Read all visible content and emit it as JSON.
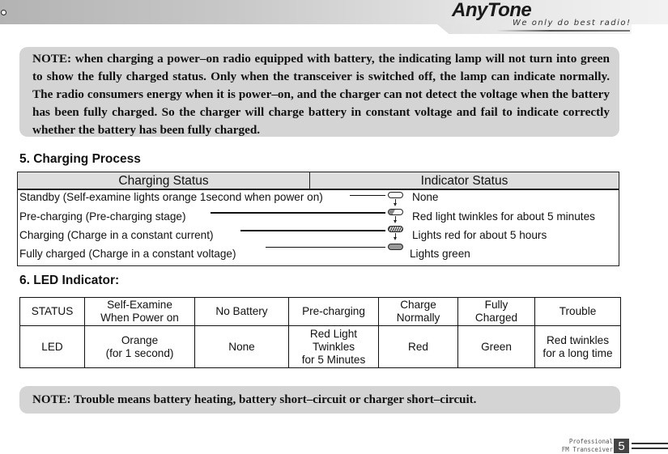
{
  "header": {
    "brand": "AnyTone",
    "tagline": "We only do best radio!"
  },
  "note_top": "NOTE: when charging a power–on radio equipped with battery, the indicating lamp will not turn into green to show the fully charged status. Only when the transceiver is switched off,  the lamp can indicate normally. The radio consumers energy when it is power–on, and the charger can not detect the voltage when the battery has been fully charged. So the charger will charge battery in constant voltage and fail to indicate correctly whether the battery has been fully charged.",
  "section5": {
    "title": "5.  Charging Process",
    "headers": [
      "Charging Status",
      "Indicator Status"
    ],
    "rows": [
      {
        "status": "Standby (Self-examine lights orange 1second when power on)",
        "indicator": "None",
        "icon": "led-off-icon"
      },
      {
        "status": "Pre-charging (Pre-charging stage)",
        "indicator": "Red light twinkles for about 5 minutes",
        "icon": "led-twinkle-icon"
      },
      {
        "status": "Charging (Charge in a constant current)",
        "indicator": "Lights red for about 5 hours",
        "icon": "led-red-icon"
      },
      {
        "status": "Fully charged (Charge in a constant voltage)",
        "indicator": "Lights green",
        "icon": "led-green-icon"
      }
    ]
  },
  "section6": {
    "title": "6.  LED Indicator:",
    "status_row": [
      "STATUS",
      "Self-Examine\nWhen Power on",
      "No Battery",
      "Pre-charging",
      "Charge\nNormally",
      "Fully\nCharged",
      "Trouble"
    ],
    "led_row": [
      "LED",
      "Orange\n(for 1 second)",
      "None",
      "Red Light\nTwinkles\nfor 5 Minutes",
      "Red",
      "Green",
      "Red twinkles\nfor a long time"
    ]
  },
  "note_bottom": "NOTE: Trouble means battery heating, battery short–circuit or charger short–circuit.",
  "footer": {
    "line1": "Professional",
    "line2": "FM Transceiver",
    "page_number": "5"
  }
}
